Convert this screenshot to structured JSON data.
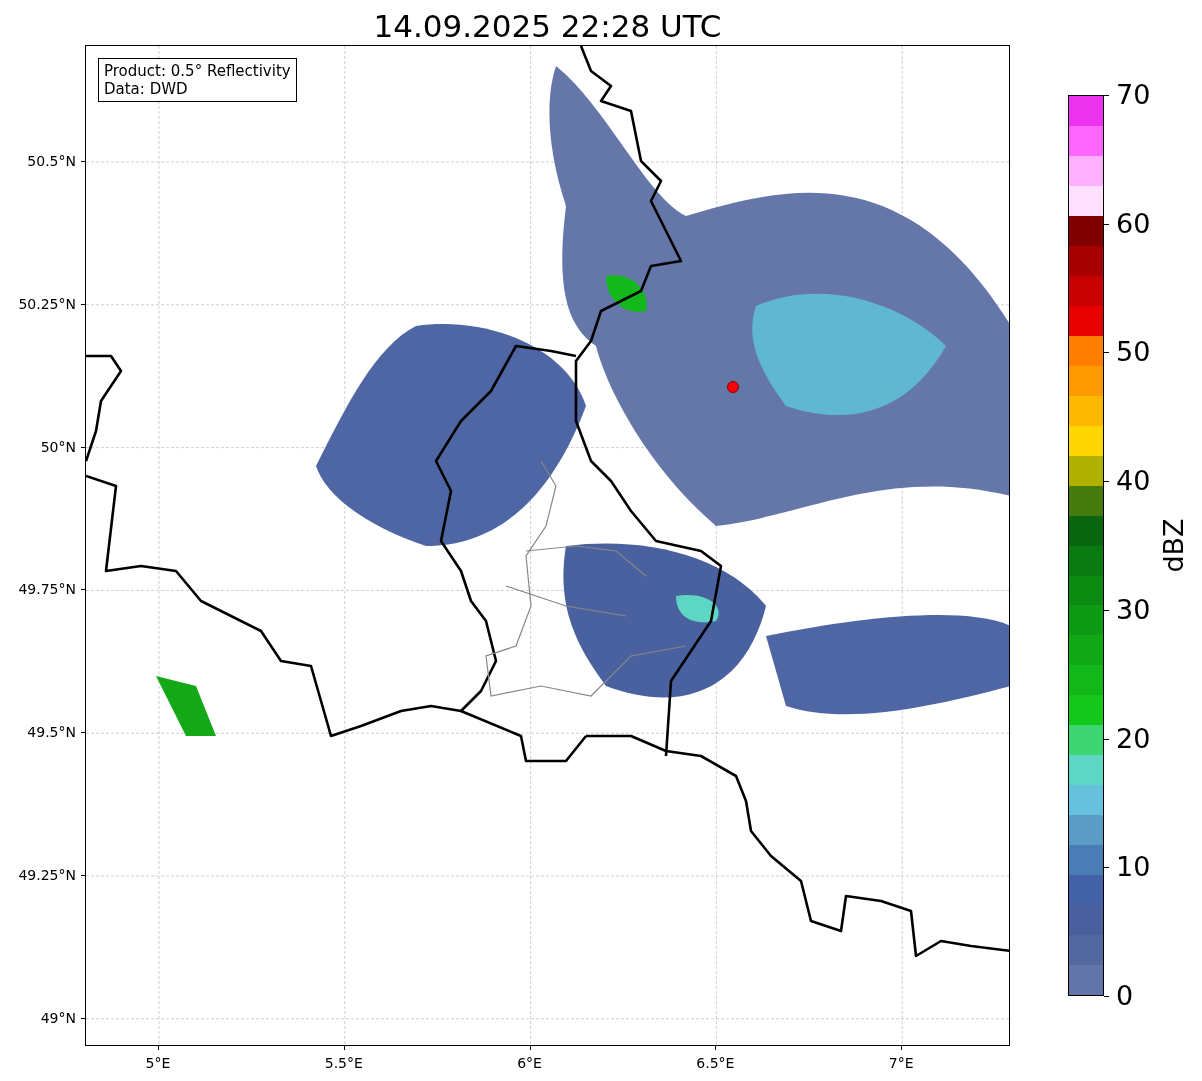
{
  "title": "14.09.2025 22:28 UTC",
  "legend": {
    "lines": [
      "Product: 0.5° Reflectivity",
      "Data: DWD"
    ]
  },
  "map": {
    "latitude_labels": [
      "50.5°N",
      "50.25°N",
      "50°N",
      "49.75°N",
      "49.5°N",
      "49.25°N",
      "49°N"
    ],
    "longitude_labels": [
      "5°E",
      "5.5°E",
      "6°E",
      "6.5°E",
      "7°E"
    ]
  },
  "colorbar": {
    "label": "dBZ",
    "tick_labels": [
      "70",
      "60",
      "50",
      "40",
      "30",
      "20",
      "10",
      "0"
    ],
    "segments": [
      {
        "color": "#ee33ee"
      },
      {
        "color": "#ff66ff"
      },
      {
        "color": "#ffb0ff"
      },
      {
        "color": "#ffe0ff"
      },
      {
        "color": "#800000"
      },
      {
        "color": "#a80000"
      },
      {
        "color": "#c80000"
      },
      {
        "color": "#e60000"
      },
      {
        "color": "#ff7e00"
      },
      {
        "color": "#ff9b00"
      },
      {
        "color": "#ffb800"
      },
      {
        "color": "#ffd600"
      },
      {
        "color": "#b0b000"
      },
      {
        "color": "#457a0e"
      },
      {
        "color": "#0a6610"
      },
      {
        "color": "#0b7a10"
      },
      {
        "color": "#0c8a12"
      },
      {
        "color": "#0e9a14"
      },
      {
        "color": "#10a816"
      },
      {
        "color": "#12b81a"
      },
      {
        "color": "#13c81a"
      },
      {
        "color": "#3dd672"
      },
      {
        "color": "#5dd6c4"
      },
      {
        "color": "#66c2dc"
      },
      {
        "color": "#5a9cc5"
      },
      {
        "color": "#4a7db5"
      },
      {
        "color": "#4361a6"
      },
      {
        "color": "#4a5f9e"
      },
      {
        "color": "#5468a0"
      },
      {
        "color": "#6374a8"
      }
    ]
  }
}
